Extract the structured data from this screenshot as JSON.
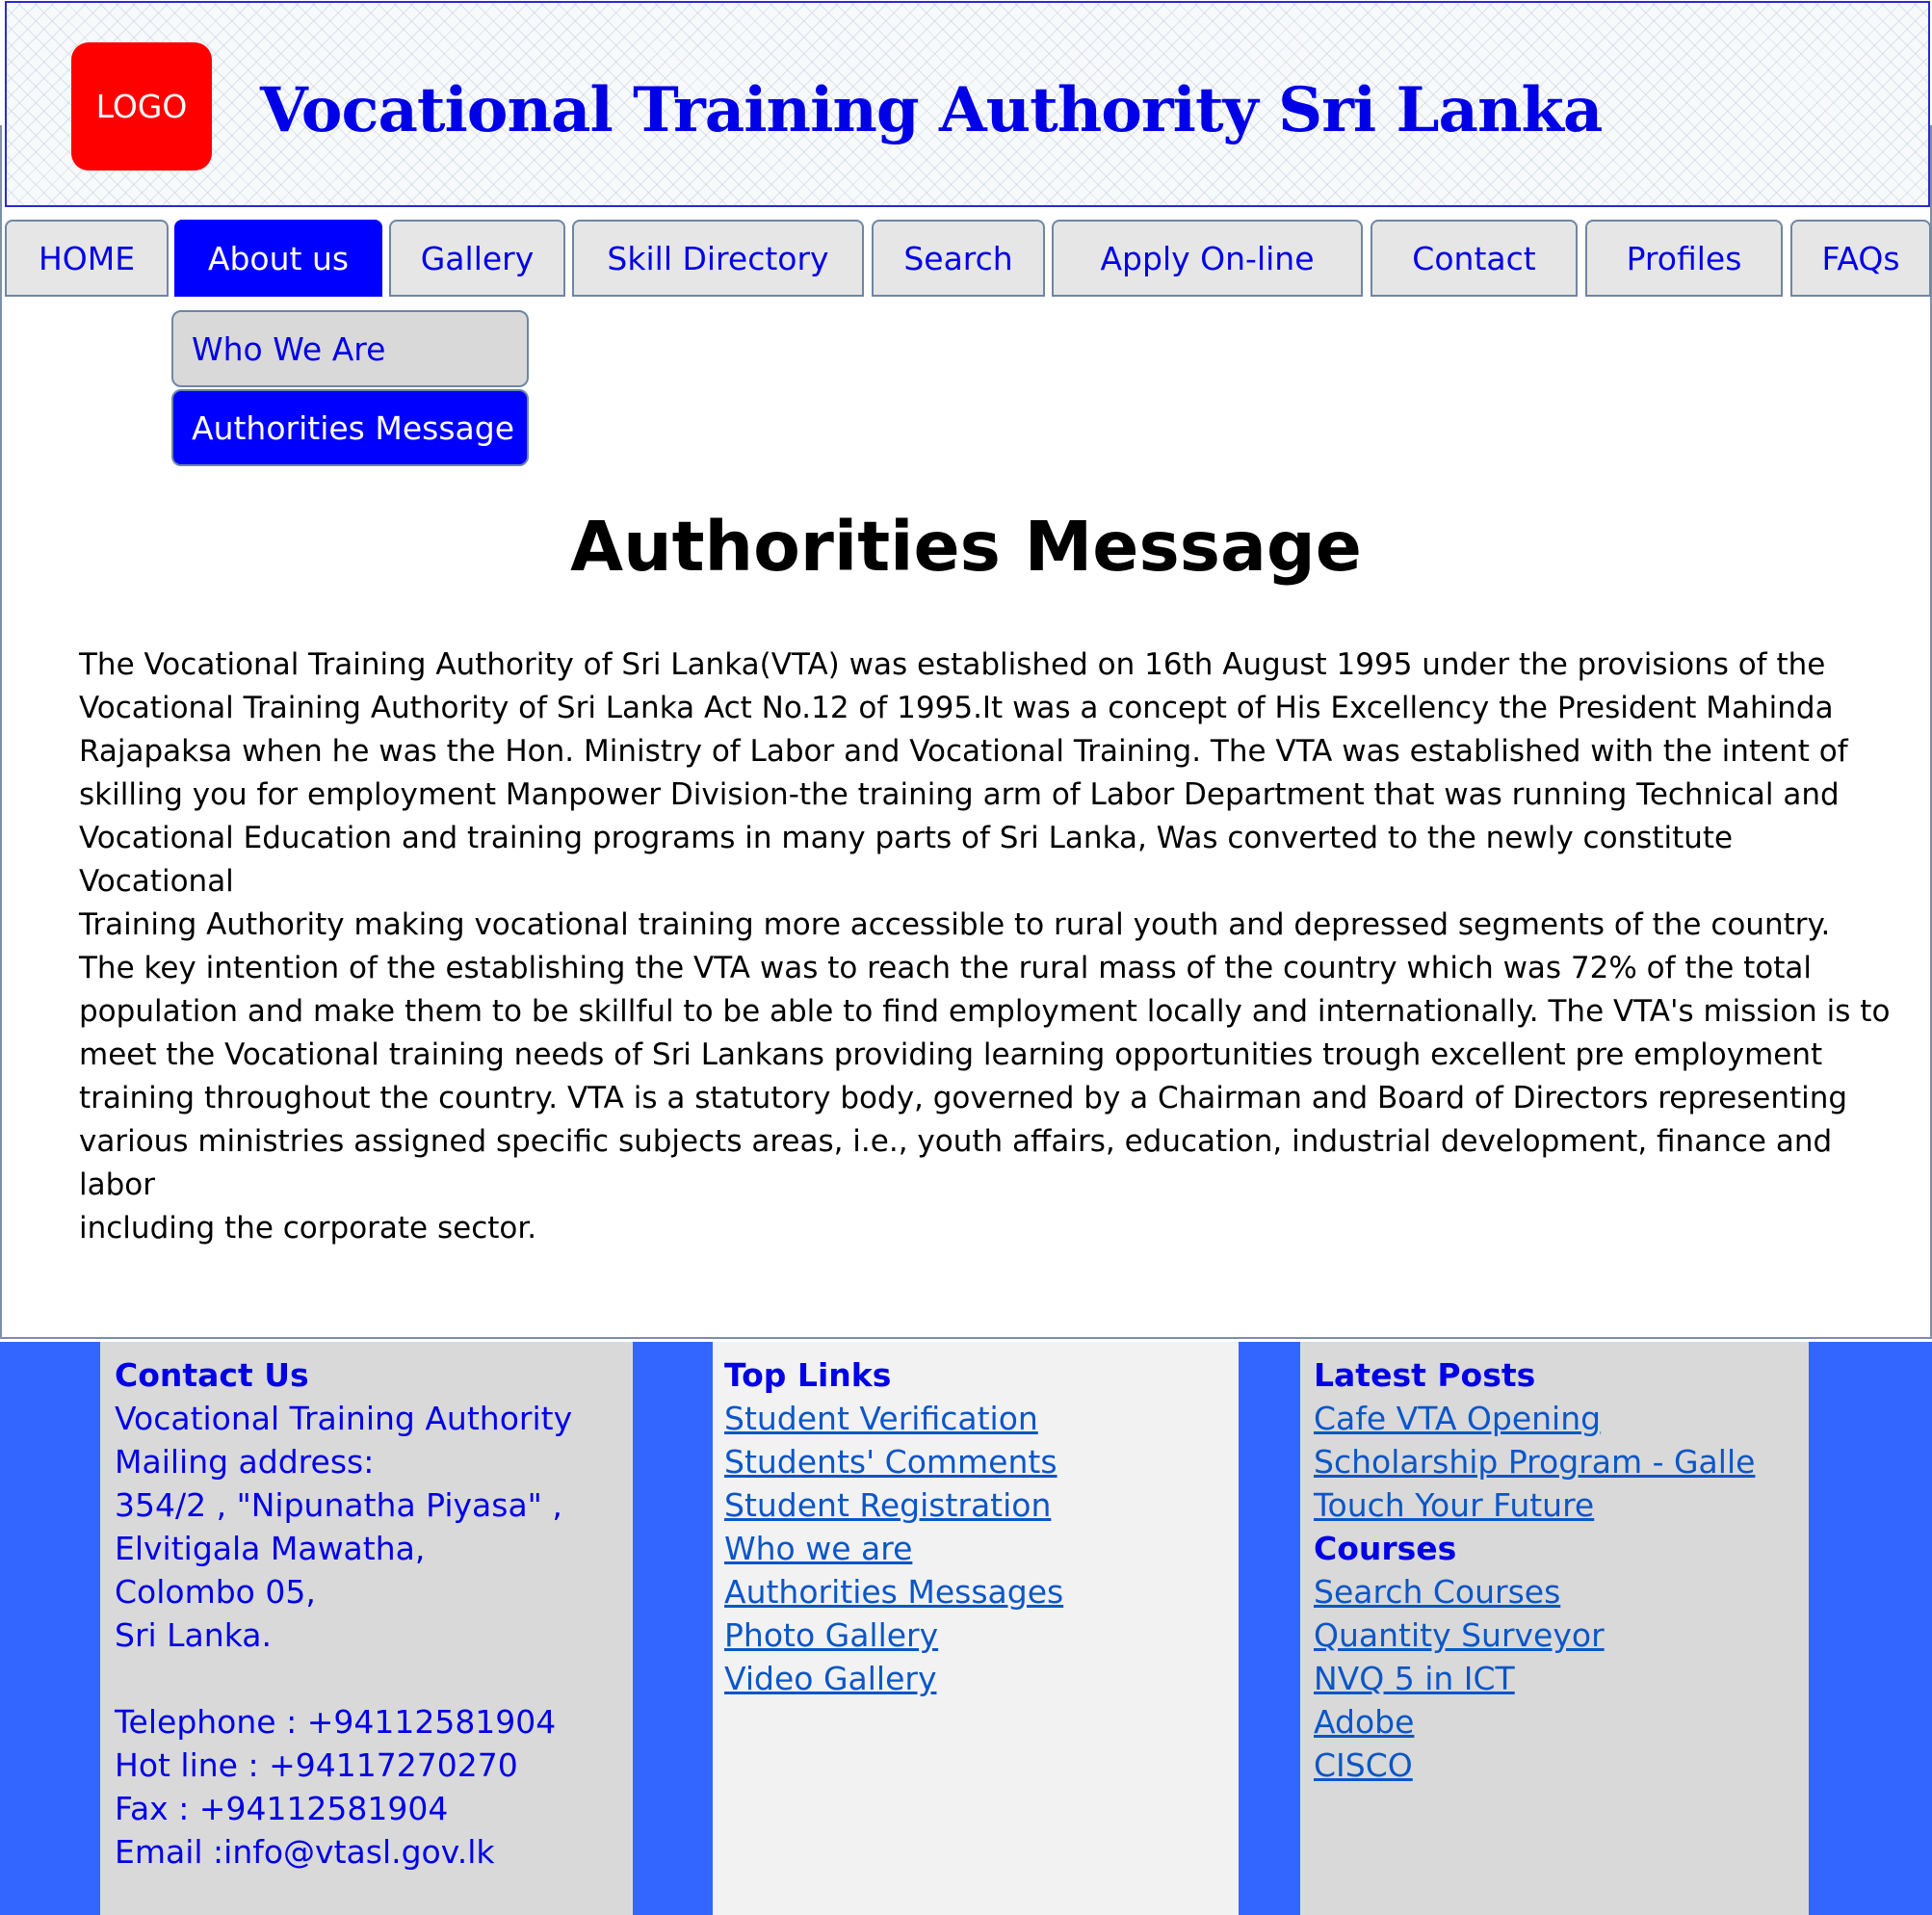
{
  "header": {
    "logo_text": "LOGO",
    "site_title": "Vocational Training Authority Sri Lanka"
  },
  "nav": {
    "tabs": [
      {
        "label": "HOME"
      },
      {
        "label": "About us"
      },
      {
        "label": "Gallery"
      },
      {
        "label": "Skill Directory"
      },
      {
        "label": "Search"
      },
      {
        "label": "Apply On-line"
      },
      {
        "label": "Contact"
      },
      {
        "label": "Profiles"
      },
      {
        "label": "FAQs"
      }
    ],
    "active_tab": "About us",
    "submenu": [
      {
        "label": "Who We Are"
      },
      {
        "label": "Authorities Message"
      }
    ],
    "active_submenu": "Authorities Message"
  },
  "main": {
    "heading": "Authorities Message",
    "body_lines": [
      "The Vocational Training Authority of Sri Lanka(VTA) was established on 16th August 1995 under the provisions of the",
      "Vocational Training Authority of Sri Lanka Act No.12 of 1995.It was a concept of His Excellency the President Mahinda",
      "Rajapaksa when he was the Hon. Ministry of Labor and Vocational Training. The VTA was established with the intent of",
      "skilling you for employment Manpower Division-the training arm of Labor Department that was running Technical and",
      "Vocational Education and training programs in many parts of Sri Lanka, Was converted to the newly constitute Vocational",
      "Training Authority making vocational training more accessible to rural youth and depressed segments of the country.",
      "The key intention of the establishing the VTA was to reach the rural mass of the country which was 72% of the total",
      "population and make them to be skillful to be able to find employment locally and internationally. The VTA's mission is to",
      "meet the Vocational training needs of Sri Lankans providing learning opportunities trough excellent pre employment",
      "training throughout the country. VTA is a statutory body, governed by a Chairman and Board of Directors representing",
      "various ministries assigned specific subjects areas, i.e., youth affairs, education, industrial development, finance and labor",
      "including the corporate sector."
    ]
  },
  "footer": {
    "contact": {
      "title": "Contact Us",
      "lines": [
        "Vocational Training Authority",
        "Mailing address:",
        "354/2 , \"Nipunatha Piyasa\" ,",
        "Elvitigala Mawatha,",
        "Colombo 05,",
        "Sri Lanka."
      ],
      "phone_lines": [
        "Telephone : +94112581904",
        "Hot line : +94117270270",
        "Fax : +94112581904",
        "Email :info@vtasl.gov.lk"
      ]
    },
    "top_links": {
      "title": "Top Links",
      "links": [
        "Student Verification",
        "Students' Comments",
        "Student Registration",
        "Who we are",
        "Authorities Messages",
        "Photo Gallery",
        "Video Gallery"
      ]
    },
    "latest_posts": {
      "title": "Latest Posts",
      "links": [
        "Cafe VTA Opening",
        "Scholarship Program - Galle",
        "Touch Your Future"
      ]
    },
    "courses": {
      "title": "Courses",
      "links": [
        "Search Courses",
        "Quantity Surveyor",
        "NVQ 5 in ICT",
        "Adobe",
        "CISCO"
      ]
    }
  },
  "colors": {
    "brand_blue": "#0000e6",
    "active_blue": "#0000ff",
    "footer_blue": "#3366ff",
    "logo_red": "#ff0000",
    "link_blue": "#0b56c8"
  }
}
